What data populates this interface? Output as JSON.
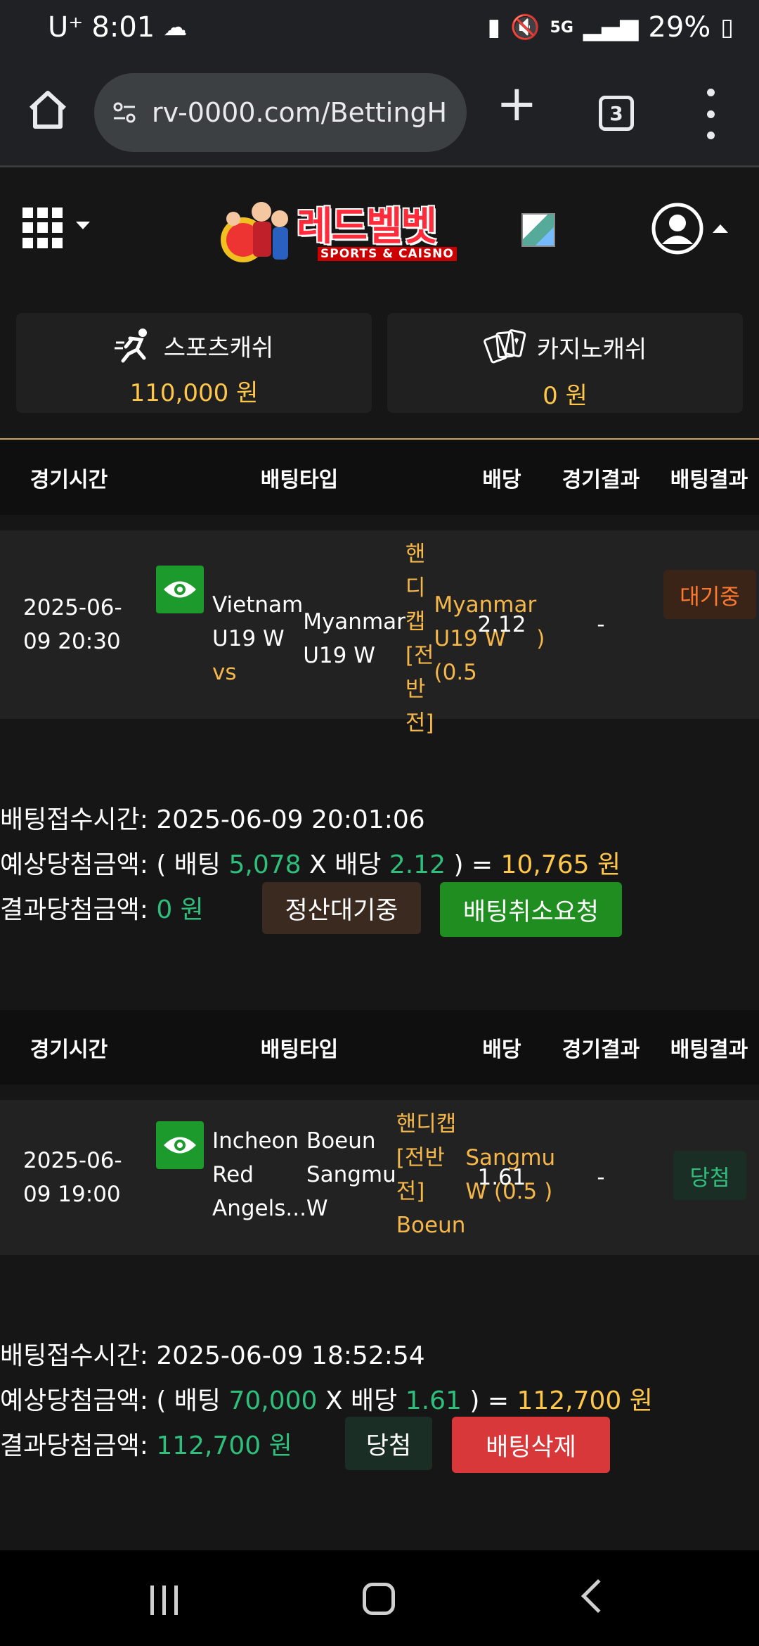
{
  "status_bar": {
    "carrier": "U⁺",
    "time": "8:01",
    "network": "5G",
    "battery": "29%"
  },
  "browser": {
    "url": "rv-0000.com/BettingH",
    "tab_count": "3"
  },
  "site": {
    "logo_text": "레드벨벳",
    "logo_sub": "SPORTS & CAISNO"
  },
  "cash": {
    "sports": {
      "label": "스포츠캐쉬",
      "amount": "110,000 원"
    },
    "casino": {
      "label": "카지노캐쉬",
      "amount": "0 원"
    }
  },
  "table_headers": {
    "time": "경기시간",
    "type": "배팅타입",
    "odds": "배당",
    "result": "경기결과",
    "bet_result": "배팅결과"
  },
  "bets": [
    {
      "time_line1": "2025-06-",
      "time_line2": "09 20:30",
      "team_home": "Vietnam U19 W",
      "vs": "vs",
      "team_away": "Myanmar U19 W",
      "market": "핸디캡 [전반전]",
      "selection_line1": "Myanmar U19 W (0.5",
      "selection_line2": ")",
      "odds": "2.12",
      "result": "-",
      "bet_result": "대기중",
      "receipt_label": "배팅접수시간:",
      "receipt_time": "2025-06-09 20:01:06",
      "expected_label": "예상당첨금액:",
      "expected_open": "( 배팅",
      "stake": "5,078",
      "x_label": "X 배당",
      "expected_odds": "2.12",
      "expected_close": ") =",
      "expected_amount": "10,765 원",
      "result_label": "결과당첨금액:",
      "result_amount": "0 원",
      "status_button": "정산대기중",
      "action_button": "배팅취소요청"
    },
    {
      "time_line1": "2025-06-",
      "time_line2": "09 19:00",
      "team_home": "Incheon Red Angels...",
      "team_away": "Boeun Sangmu W",
      "market": "핸디캡 [전반전] Boeun",
      "selection_line1": "Sangmu W (0.5 )",
      "odds": "1.61",
      "result": "-",
      "bet_result": "당첨",
      "receipt_label": "배팅접수시간:",
      "receipt_time": "2025-06-09 18:52:54",
      "expected_label": "예상당첨금액:",
      "expected_open": "( 배팅",
      "stake": "70,000",
      "x_label": "X 배당",
      "expected_odds": "1.61",
      "expected_close": ") =",
      "expected_amount": "112,700 원",
      "result_label": "결과당첨금액:",
      "result_amount": "112,700 원",
      "status_button": "당첨",
      "action_button": "배팅삭제"
    }
  ],
  "colors": {
    "gold": "#f5b749",
    "green": "#2fbf7d",
    "waiting_orange": "#ff7a2f",
    "cancel_green": "#1f8d1f",
    "delete_red": "#d9383a"
  }
}
